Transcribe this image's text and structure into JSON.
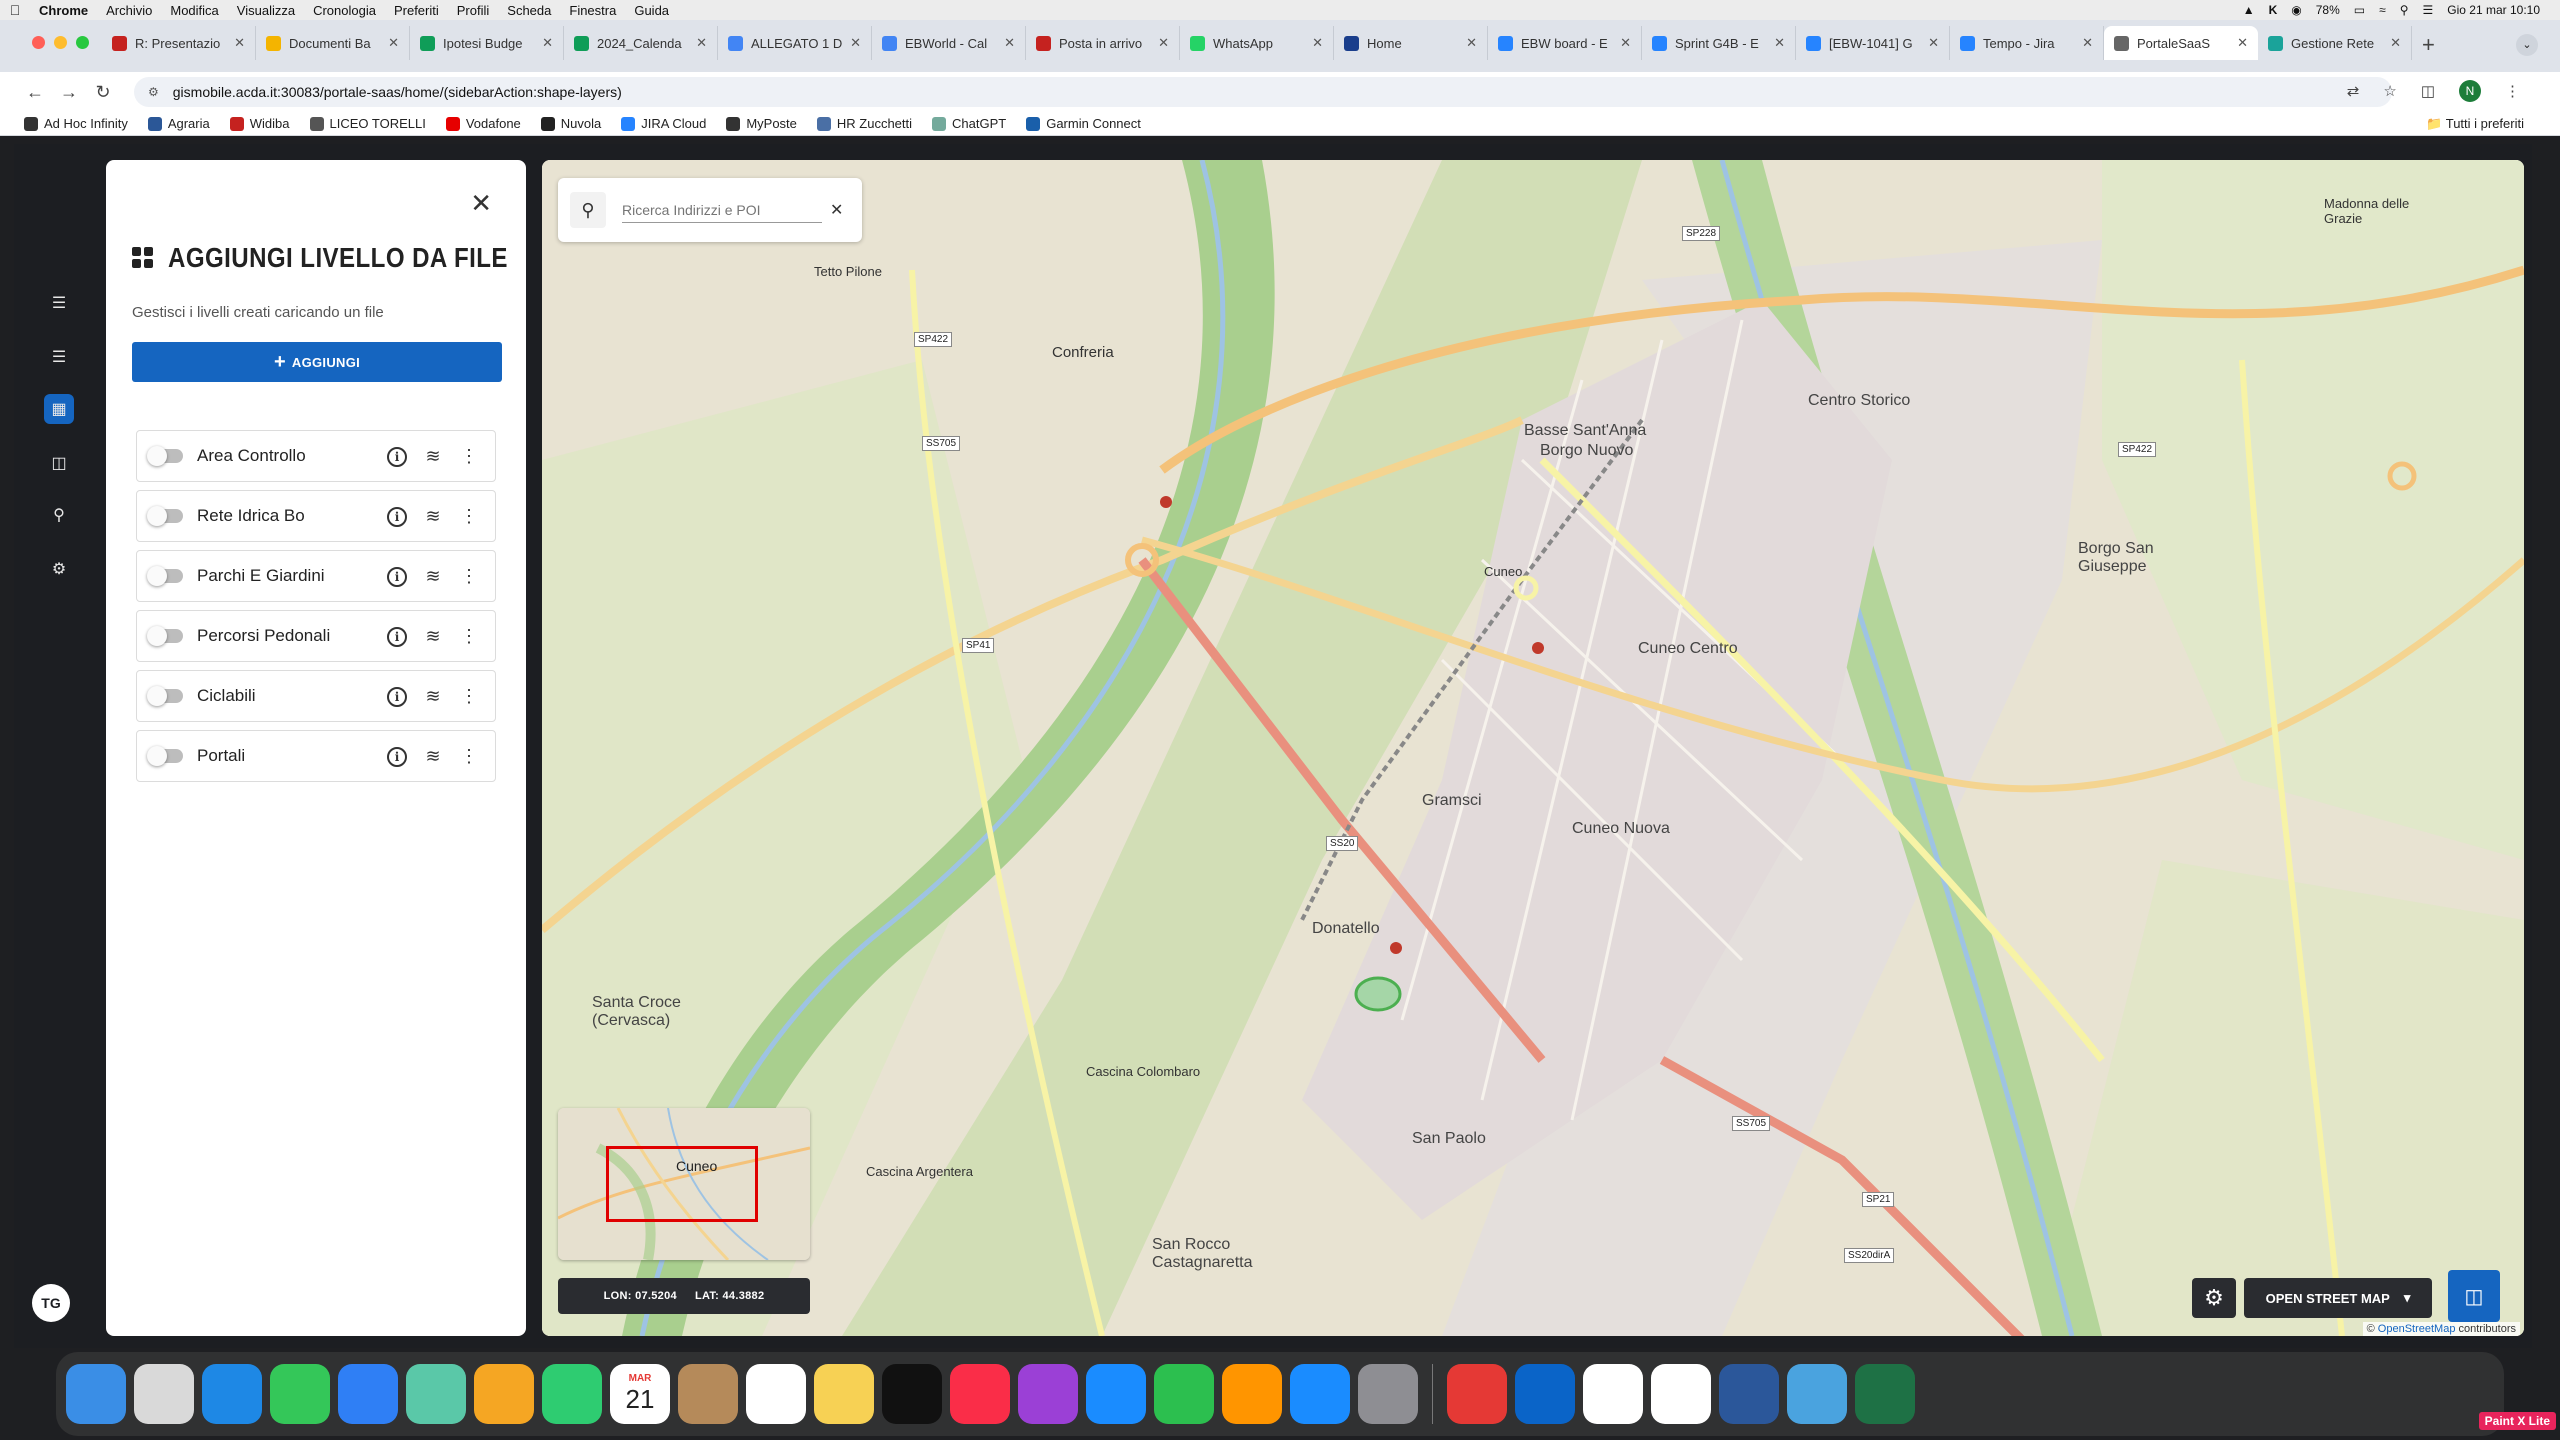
{
  "os_menubar": {
    "app_name": "Chrome",
    "menus": [
      "Archivio",
      "Modifica",
      "Visualizza",
      "Cronologia",
      "Preferiti",
      "Profili",
      "Scheda",
      "Finestra",
      "Guida"
    ],
    "battery": "78%",
    "clock": "Gio 21 mar 10:10"
  },
  "browser": {
    "tabs": [
      {
        "label": "R: Presentazio",
        "color": "#c5221f"
      },
      {
        "label": "Documenti Ba",
        "color": "#f4b400"
      },
      {
        "label": "Ipotesi Budge",
        "color": "#0f9d58"
      },
      {
        "label": "2024_Calenda",
        "color": "#0f9d58"
      },
      {
        "label": "ALLEGATO 1 D",
        "color": "#4285f4"
      },
      {
        "label": "EBWorld - Cal",
        "color": "#4285f4"
      },
      {
        "label": "Posta in arrivo",
        "color": "#c5221f"
      },
      {
        "label": "WhatsApp",
        "color": "#25d366"
      },
      {
        "label": "Home",
        "color": "#1a3e8c"
      },
      {
        "label": "EBW board - E",
        "color": "#2684ff"
      },
      {
        "label": "Sprint G4B - E",
        "color": "#2684ff"
      },
      {
        "label": "[EBW-1041] G",
        "color": "#2684ff"
      },
      {
        "label": "Tempo - Jira",
        "color": "#2684ff"
      },
      {
        "label": "PortaleSaaS",
        "color": "#666666",
        "active": true
      },
      {
        "label": "Gestione Rete",
        "color": "#1aa39a"
      }
    ],
    "url": "gismobile.acda.it:30083/portale-saas/home/(sidebarAction:shape-layers)",
    "profile_initial": "N",
    "bookmarks": [
      {
        "label": "Ad Hoc Infinity",
        "color": "#333333"
      },
      {
        "label": "Agraria",
        "color": "#2b5797"
      },
      {
        "label": "Widiba",
        "color": "#c5221f"
      },
      {
        "label": "LICEO TORELLI",
        "color": "#555555"
      },
      {
        "label": "Vodafone",
        "color": "#e60000"
      },
      {
        "label": "Nuvola",
        "color": "#222222"
      },
      {
        "label": "JIRA Cloud",
        "color": "#2684ff"
      },
      {
        "label": "MyPoste",
        "color": "#333333"
      },
      {
        "label": "HR Zucchetti",
        "color": "#4a6fa5"
      },
      {
        "label": "ChatGPT",
        "color": "#74aa9c"
      },
      {
        "label": "Garmin Connect",
        "color": "#1a5faa"
      }
    ],
    "bookmarks_folder": "Tutti i preferiti"
  },
  "sidebar_rail": {
    "icons": [
      "layers-icon",
      "stacked-layers-icon",
      "shape-layers-icon",
      "document-icon",
      "search-tool-icon",
      "route-icon"
    ],
    "user_initials": "TG"
  },
  "panel": {
    "title": "AGGIUNGI LIVELLO DA FILE",
    "subtitle": "Gestisci i livelli creati caricando un file",
    "add_button": "AGGIUNGI",
    "layers": [
      {
        "name": "Area Controllo",
        "enabled": false
      },
      {
        "name": "Rete Idrica Bo",
        "enabled": false
      },
      {
        "name": "Parchi E Giardini",
        "enabled": false
      },
      {
        "name": "Percorsi Pedonali",
        "enabled": false
      },
      {
        "name": "Ciclabili",
        "enabled": false
      },
      {
        "name": "Portali",
        "enabled": false
      }
    ]
  },
  "map": {
    "search_placeholder": "Ricerca Indirizzi e POI",
    "coord_lon": "LON: 07.5204",
    "coord_lat": "LAT: 44.3882",
    "basemap_label": "OPEN STREET MAP",
    "attribution_prefix": "©",
    "attribution_link": "OpenStreetMap",
    "attribution_suffix": "contributors",
    "minimap_label": "Cuneo",
    "places": [
      "Confreria",
      "Cuneo",
      "Basse Sant'Anna",
      "Borgo Nuovo",
      "Centro Storico",
      "Cuneo Centro",
      "Gramsci",
      "Cuneo Nuova",
      "Donatello",
      "San Paolo",
      "Borgo San Giuseppe",
      "Santa Croce (Cervasca)",
      "San Rocco Castagnaretta",
      "Cascina Colombaro",
      "Cascina Argentera",
      "Madonna delle Grazie",
      "Tetto Pilone"
    ],
    "road_labels": [
      "SP422",
      "SS705",
      "SP228",
      "SP422",
      "SS20",
      "SS705",
      "SP21",
      "SS20dirA",
      "SP41"
    ]
  },
  "dock": {
    "calendar_month": "MAR",
    "calendar_day": "21",
    "apps": [
      {
        "name": "finder-icon",
        "color": "#3a8ee6"
      },
      {
        "name": "launchpad-icon",
        "color": "#d9d9d9"
      },
      {
        "name": "safari-icon",
        "color": "#1e88e5"
      },
      {
        "name": "messages-icon",
        "color": "#34c759"
      },
      {
        "name": "mail-icon",
        "color": "#2f7ff5"
      },
      {
        "name": "maps-icon",
        "color": "#5ac8a8"
      },
      {
        "name": "photos-icon",
        "color": "#f5a623"
      },
      {
        "name": "facetime-icon",
        "color": "#2ecc71"
      },
      {
        "name": "calendar-icon",
        "color": "#ffffff"
      },
      {
        "name": "contacts-icon",
        "color": "#b58a5a"
      },
      {
        "name": "reminders-icon",
        "color": "#ffffff"
      },
      {
        "name": "notes-icon",
        "color": "#f7d154"
      },
      {
        "name": "tv-icon",
        "color": "#111111"
      },
      {
        "name": "music-icon",
        "color": "#fa2d48"
      },
      {
        "name": "podcasts-icon",
        "color": "#9b40d6"
      },
      {
        "name": "keynote-icon",
        "color": "#1a8cff"
      },
      {
        "name": "numbers-icon",
        "color": "#2cbf4f"
      },
      {
        "name": "pages-icon",
        "color": "#ff9500"
      },
      {
        "name": "app-store-icon",
        "color": "#1a8cff"
      },
      {
        "name": "system-settings-icon",
        "color": "#8e8e93"
      }
    ],
    "apps2": [
      {
        "name": "anydesk-icon",
        "color": "#e53935"
      },
      {
        "name": "outlook-icon",
        "color": "#0a64c8"
      },
      {
        "name": "slack-icon",
        "color": "#ffffff"
      },
      {
        "name": "chrome-icon",
        "color": "#ffffff"
      },
      {
        "name": "word-icon",
        "color": "#2b579a"
      },
      {
        "name": "preview-icon",
        "color": "#4aa3df"
      },
      {
        "name": "excel-icon",
        "color": "#1e7145"
      }
    ],
    "paint_x": "Paint X Lite"
  }
}
